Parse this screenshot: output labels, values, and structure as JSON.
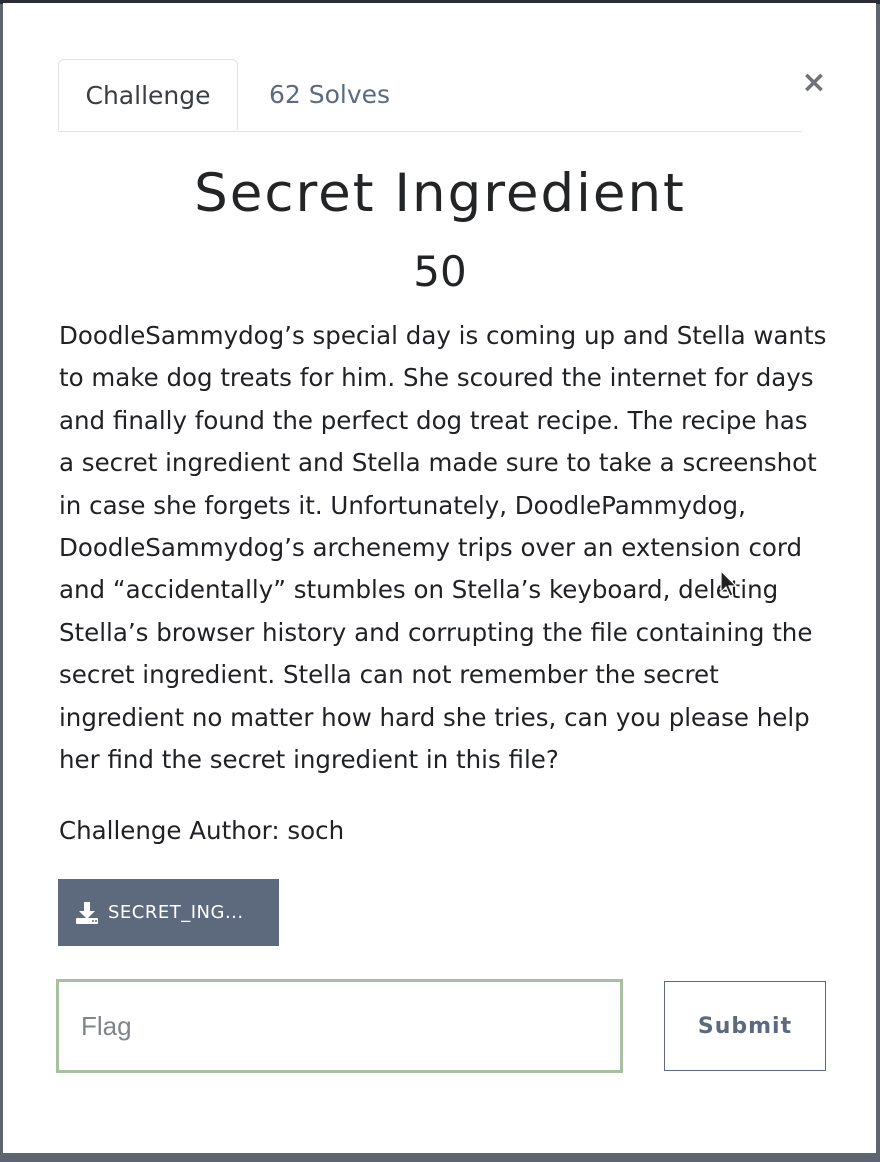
{
  "modal": {
    "close_label": "×",
    "tabs": [
      {
        "label": "Challenge",
        "active": true
      },
      {
        "label": "62 Solves",
        "active": false
      }
    ],
    "title": "Secret Ingredient",
    "points": "50",
    "description": "DoodleSammydog’s special day is coming up and Stella wants to make dog treats for him. She scoured the internet for days and finally found the perfect dog treat recipe. The recipe has a secret ingredient and Stella made sure to take a screenshot in case she forgets it. Unfortunately, DoodlePammydog, DoodleSammydog’s archenemy trips over an extension cord and “accidentally” stumbles on Stella’s keyboard, deleting Stella’s browser history and corrupting the file containing the secret ingredient. Stella can not remember the secret ingredient no matter how hard she tries, can you please help her find the secret ingredient in this file?",
    "author": "Challenge Author: soch",
    "file_button": {
      "label": "SECRET_ING...",
      "icon": "download-icon"
    },
    "flag_input": {
      "value": "",
      "placeholder": "Flag"
    },
    "submit_label": "Submit"
  },
  "colors": {
    "accent": "#5d6a7e",
    "input_focus_border": "#a8bfa2",
    "backdrop": "#5e6571"
  }
}
